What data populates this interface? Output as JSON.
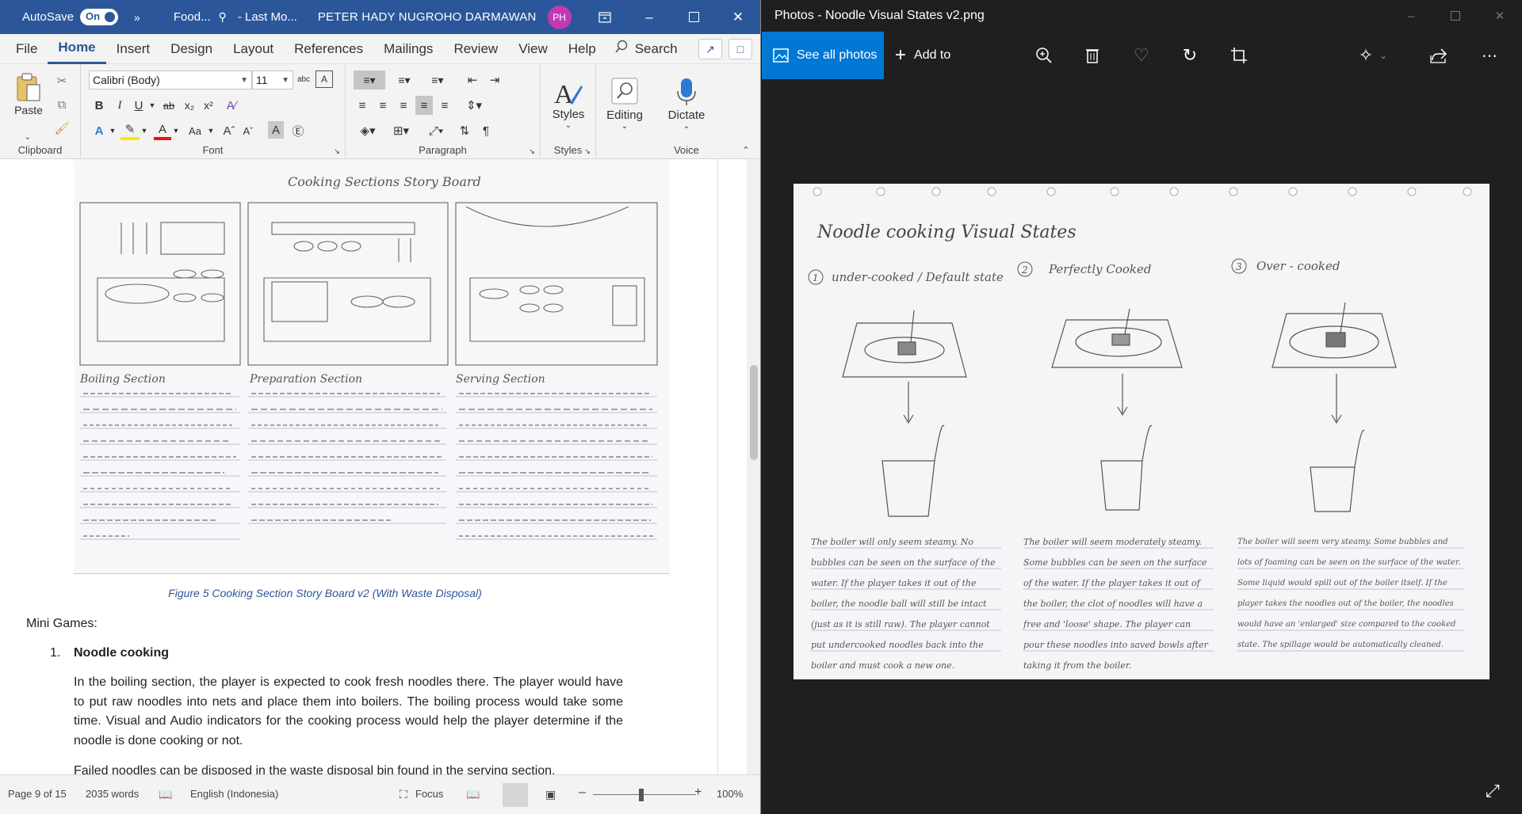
{
  "word": {
    "title_bar": {
      "autosave_label": "AutoSave",
      "autosave_state": "On",
      "more": "»",
      "doc_name": "Food...",
      "last_modified": "- Last Mo...",
      "user_name": "PETER HADY NUGROHO DARMAWAN",
      "user_initials": "PH"
    },
    "tabs": [
      "File",
      "Home",
      "Insert",
      "Design",
      "Layout",
      "References",
      "Mailings",
      "Review",
      "View",
      "Help"
    ],
    "active_tab": "Home",
    "search_label": "Search",
    "ribbon": {
      "clipboard": {
        "label": "Clipboard",
        "paste": "Paste"
      },
      "font": {
        "label": "Font",
        "font_name": "Calibri (Body)",
        "font_size": "11"
      },
      "paragraph": {
        "label": "Paragraph"
      },
      "styles": {
        "label": "Styles",
        "button": "Styles"
      },
      "editing": {
        "button": "Editing"
      },
      "voice": {
        "label": "Voice",
        "button": "Dictate"
      }
    },
    "document": {
      "figure_caption": "Figure 5 Cooking Section Story Board v2 (With Waste Disposal)",
      "storyboard_title": "Cooking Sections Story Board",
      "panel_titles": [
        "Boiling Section",
        "Preparation Section",
        "Serving Section"
      ],
      "mini_games_label": "Mini Games:",
      "list_number": "1.",
      "list_heading": "Noodle cooking",
      "paragraph1": "In the boiling section, the player is expected to cook fresh noodles there. The player would have to put raw noodles into nets and place them into boilers. The boiling process would take some time. Visual and Audio indicators for the cooking process would help the player determine if the noodle is done cooking or not.",
      "paragraph2": "Failed noodles can be disposed in the waste disposal bin found in the serving section."
    },
    "status_bar": {
      "page": "Page 9 of 15",
      "words": "2035 words",
      "language": "English (Indonesia)",
      "focus": "Focus",
      "zoom": "100%"
    }
  },
  "photos": {
    "title": "Photos - Noodle Visual States v2.png",
    "see_all": "See all photos",
    "add_to": "Add to",
    "image": {
      "title": "Noodle cooking Visual States",
      "states": [
        "under-cooked / Default state",
        "Perfectly Cooked",
        "Over - cooked"
      ],
      "descriptions": [
        "The boiler will only seem steamy. No bubbles can be seen on the surface of the water. If the player takes it out of the boiler, the noodle ball will still be intact (just as it is still raw). The player cannot put undercooked noodles back into the boiler and must cook a new one.",
        "The boiler will seem moderately steamy. Some bubbles can be seen on the surface of the water. If the player takes it out of the boiler, the clot of noodles will have a free and 'loose' shape. The player can pour these noodles into saved bowls after taking it from the boiler.",
        "The boiler will seem very steamy. Some bubbles and lots of foaming can be seen on the surface of the water. Some liquid would spill out of the boiler itself. If the player takes the noodles out of the boiler, the noodles would have an 'enlarged' size compared to the cooked state. The spillage would be automatically cleaned."
      ]
    }
  }
}
